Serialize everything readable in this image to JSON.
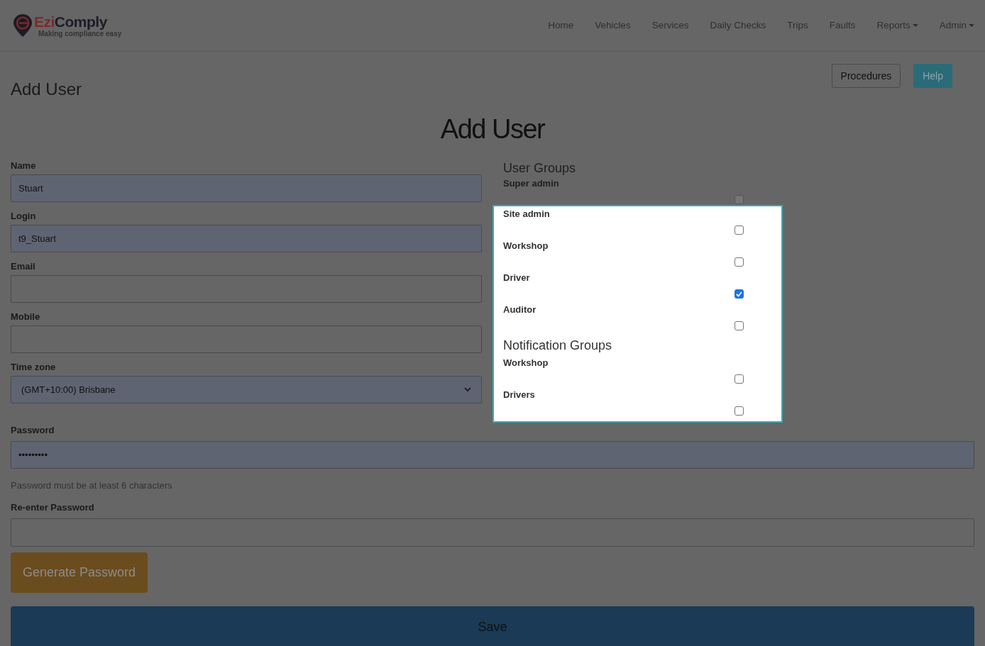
{
  "brand": {
    "name_first": "Ezi",
    "name_rest": "Comply",
    "tagline": "Making compliance easy"
  },
  "nav": [
    {
      "label": "Home",
      "kind": "link"
    },
    {
      "label": "Vehicles",
      "kind": "link"
    },
    {
      "label": "Services",
      "kind": "link"
    },
    {
      "label": "Daily Checks",
      "kind": "link"
    },
    {
      "label": "Trips",
      "kind": "link"
    },
    {
      "label": "Faults",
      "kind": "link"
    },
    {
      "label": "Reports",
      "kind": "dropdown"
    },
    {
      "label": "Admin",
      "kind": "dropdown"
    }
  ],
  "page_title": "Add User",
  "header_buttons": [
    {
      "label": "Procedures",
      "kind": "outline"
    },
    {
      "label": "Help",
      "kind": "info"
    }
  ],
  "form_title": "Add User",
  "fields": [
    {
      "label": "Name",
      "kind": "text",
      "value": "Stuart"
    },
    {
      "label": "Login",
      "kind": "text",
      "value": "t9_Stuart"
    },
    {
      "label": "Email",
      "kind": "text"
    },
    {
      "label": "Mobile",
      "kind": "text"
    },
    {
      "label": "Time zone",
      "kind": "select",
      "value": "(GMT+10:00) Brisbane"
    }
  ],
  "user_groups": {
    "title": "User Groups",
    "items": [
      {
        "label": "Super admin",
        "checked": false,
        "highlighted": false
      },
      {
        "label": "Site admin",
        "checked": false,
        "highlighted": true
      },
      {
        "label": "Workshop",
        "checked": false,
        "highlighted": true
      },
      {
        "label": "Driver",
        "checked": true,
        "highlighted": true
      },
      {
        "label": "Auditor",
        "checked": false,
        "highlighted": true
      }
    ]
  },
  "notification_groups": {
    "title": "Notification Groups",
    "highlighted": true,
    "items": [
      {
        "label": "Workshop",
        "checked": false
      },
      {
        "label": "Drivers",
        "checked": false
      }
    ]
  },
  "password": {
    "label": "Password",
    "value": "•••••••••",
    "hint": "Password must be at least 6 characters"
  },
  "reenter_password": {
    "label": "Re-enter Password"
  },
  "generate_button": "Generate Password",
  "save_button": "Save"
}
